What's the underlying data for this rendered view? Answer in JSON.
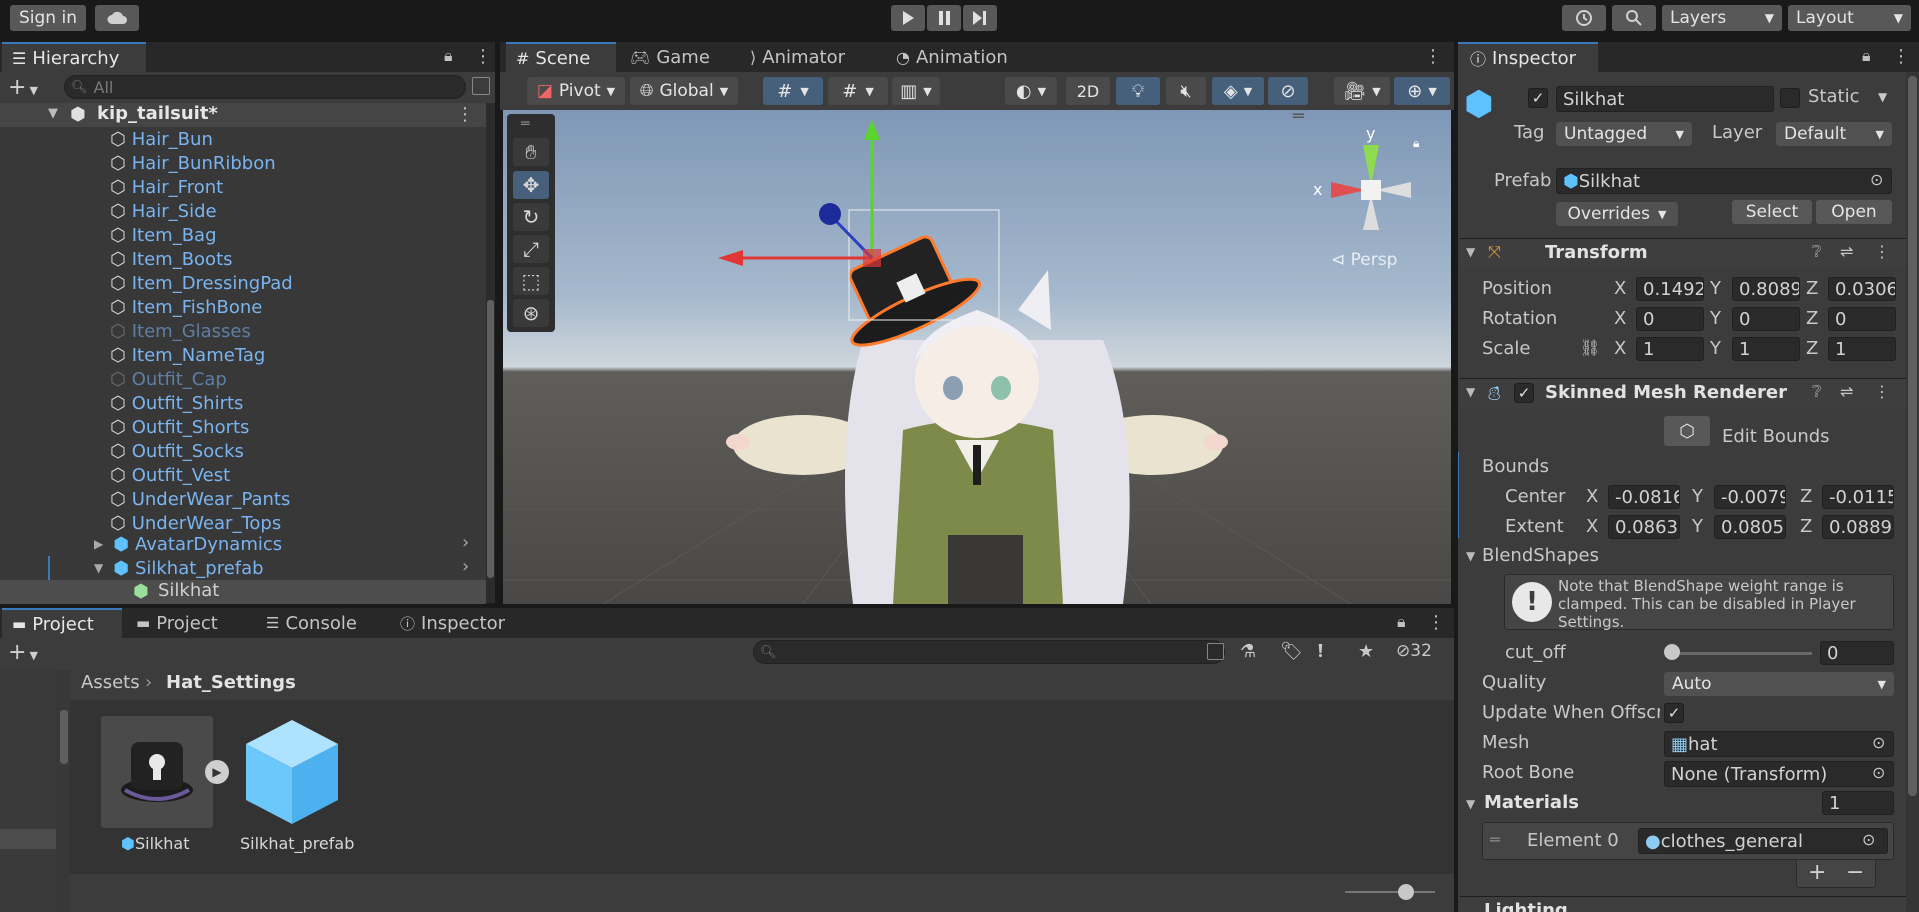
{
  "toolbar": {
    "sign_in": "Sign in",
    "layers": "Layers",
    "layout": "Layout"
  },
  "hierarchy": {
    "tab": "Hierarchy",
    "search_placeholder": "All",
    "scene_name": "kip_tailsuit*",
    "items": [
      {
        "label": "Hair_Bun",
        "active": true
      },
      {
        "label": "Hair_BunRibbon",
        "active": true
      },
      {
        "label": "Hair_Front",
        "active": true
      },
      {
        "label": "Hair_Side",
        "active": true
      },
      {
        "label": "Item_Bag",
        "active": true
      },
      {
        "label": "Item_Boots",
        "active": true
      },
      {
        "label": "Item_DressingPad",
        "active": true
      },
      {
        "label": "Item_FishBone",
        "active": true
      },
      {
        "label": "Item_Glasses",
        "active": false
      },
      {
        "label": "Item_NameTag",
        "active": true
      },
      {
        "label": "Outfit_Cap",
        "active": false
      },
      {
        "label": "Outfit_Shirts",
        "active": true
      },
      {
        "label": "Outfit_Shorts",
        "active": true
      },
      {
        "label": "Outfit_Socks",
        "active": true
      },
      {
        "label": "Outfit_Vest",
        "active": true
      },
      {
        "label": "UnderWear_Pants",
        "active": true
      },
      {
        "label": "UnderWear_Tops",
        "active": true
      }
    ],
    "avatar_dynamics": "AvatarDynamics",
    "prefab": "Silkhat_prefab",
    "selected": "Silkhat"
  },
  "scene": {
    "tabs": [
      "Scene",
      "Game",
      "Animator",
      "Animation"
    ],
    "pivot": "Pivot",
    "global": "Global",
    "mode_2d": "2D",
    "persp": "⊲ Persp",
    "gizmo_x": "x",
    "gizmo_y": "y"
  },
  "project": {
    "tabs": [
      "Project",
      "Project",
      "Console",
      "Inspector"
    ],
    "breadcrumb_root": "Assets",
    "breadcrumb_folder": "Hat_Settings",
    "hidden_count": "32",
    "assets": [
      {
        "label": "Silkhat"
      },
      {
        "label": "Silkhat_prefab"
      }
    ]
  },
  "inspector": {
    "tab": "Inspector",
    "object_name": "Silkhat",
    "static_label": "Static",
    "tag_label": "Tag",
    "tag_value": "Untagged",
    "layer_label": "Layer",
    "layer_value": "Default",
    "prefab_label": "Prefab",
    "prefab_value": "Silkhat",
    "overrides": "Overrides",
    "select": "Select",
    "open": "Open",
    "transform": {
      "title": "Transform",
      "position_label": "Position",
      "rotation_label": "Rotation",
      "scale_label": "Scale",
      "position": [
        "0.1492",
        "0.8089",
        "0.0306"
      ],
      "rotation": [
        "0",
        "0",
        "0"
      ],
      "scale": [
        "1",
        "1",
        "1"
      ]
    },
    "smr": {
      "title": "Skinned Mesh Renderer",
      "edit_bounds": "Edit Bounds",
      "bounds_label": "Bounds",
      "center_label": "Center",
      "extent_label": "Extent",
      "center": [
        "-0.0816",
        "-0.0079",
        "-0.0115"
      ],
      "extent": [
        "0.08632",
        "0.08050",
        "0.08894"
      ],
      "blendshapes_label": "BlendShapes",
      "note": "Note that BlendShape weight range is clamped. This can be disabled in Player Settings.",
      "cut_off_label": "cut_off",
      "cut_off_value": "0",
      "quality_label": "Quality",
      "quality_value": "Auto",
      "update_label": "Update When Offscr",
      "mesh_label": "Mesh",
      "mesh_value": "hat",
      "root_bone_label": "Root Bone",
      "root_bone_value": "None (Transform)",
      "materials_label": "Materials",
      "materials_count": "1",
      "element_label": "Element 0",
      "element_value": "clothes_general",
      "lighting_label": "Lighting"
    }
  },
  "axes": {
    "x": "X",
    "y": "Y",
    "z": "Z"
  }
}
